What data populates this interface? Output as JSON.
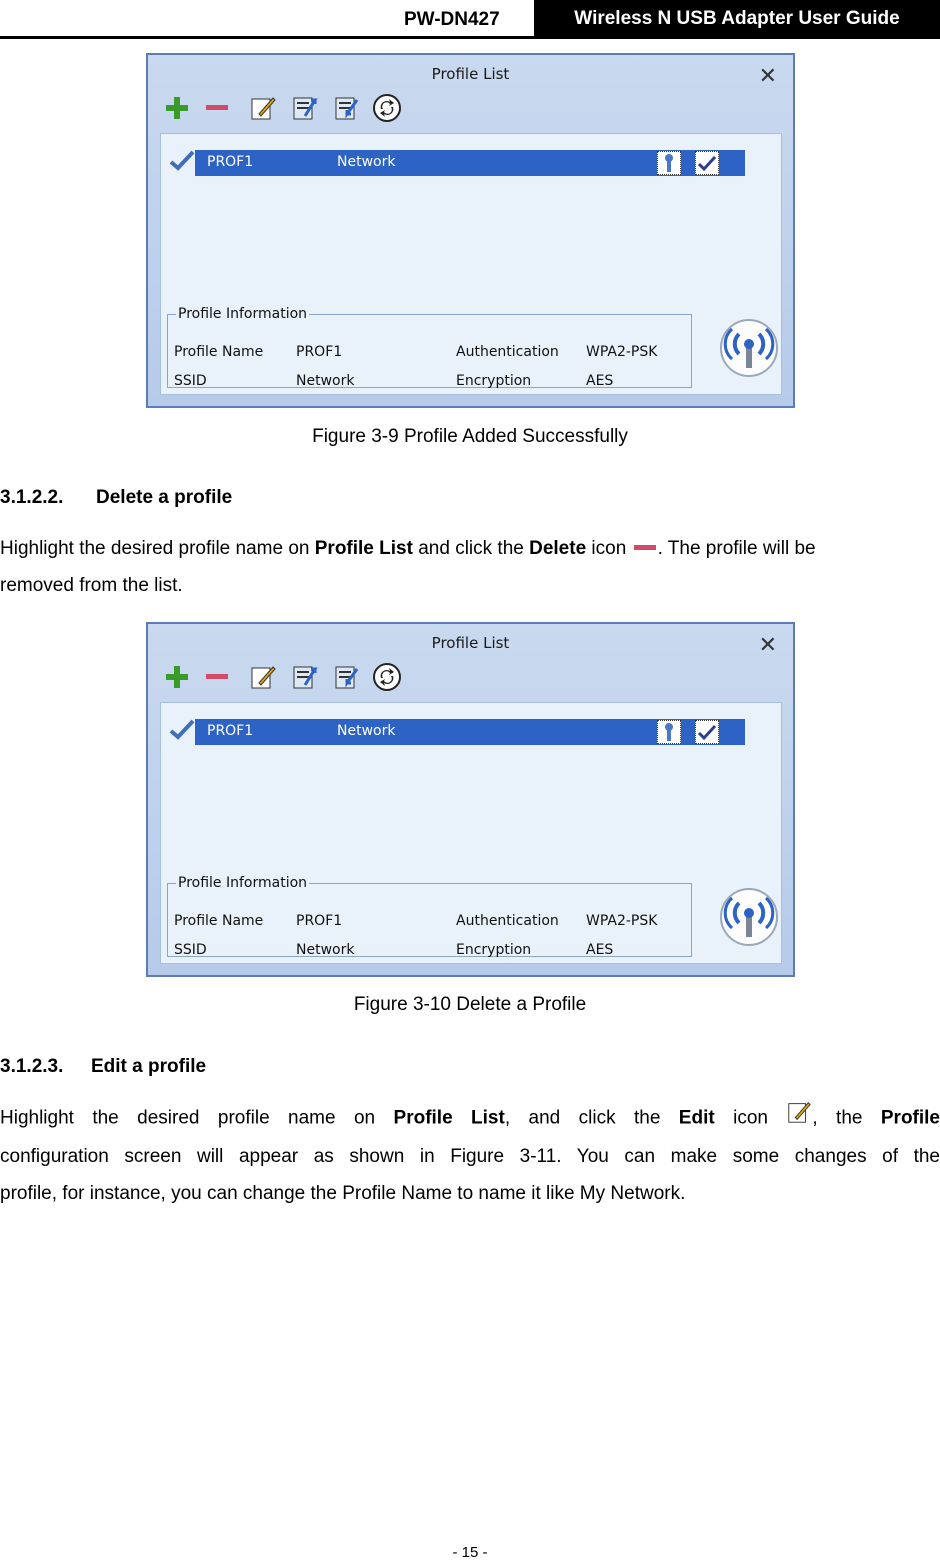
{
  "header": {
    "model": "PW-DN427",
    "title": "Wireless N USB Adapter User Guide"
  },
  "profile_window": {
    "title": "Profile List",
    "close_symbol": "✕",
    "toolbar_icons": [
      "add-icon",
      "delete-icon",
      "edit-icon",
      "import-icon",
      "export-icon",
      "scan-icon"
    ],
    "profile_row": {
      "name": "PROF1",
      "ssid": "Network"
    },
    "info": {
      "legend": "Profile Information",
      "profile_name_label": "Profile Name",
      "profile_name_value": "PROF1",
      "ssid_label": "SSID",
      "ssid_value": "Network",
      "auth_label": "Authentication",
      "auth_value": "WPA2-PSK",
      "enc_label": "Encryption",
      "enc_value": "AES"
    }
  },
  "captions": {
    "fig1": "Figure 3-9 Profile Added Successfully",
    "fig2": "Figure 3-10 Delete a Profile"
  },
  "sections": {
    "delete": {
      "number": "3.1.2.2.",
      "title": "Delete a profile",
      "p1": "Highlight the desired profile name on ",
      "b1": "Profile List",
      "p2": " and click the ",
      "b2": "Delete",
      "p3": " icon ",
      "p4": ". The profile will be",
      "line2": "removed from the list."
    },
    "edit": {
      "number": "3.1.2.3.",
      "title": "Edit a profile",
      "p1": "Highlight the desired profile name on ",
      "b1": "Profile List",
      "p2": ", and click the ",
      "b2": "Edit",
      "p3": " icon ",
      "p4": ", the ",
      "b3": "Profile",
      "line2": "configuration screen will appear as shown in Figure 3-11. You can make some changes of the",
      "line3": "profile, for instance, you can change the Profile Name to name it like My Network."
    }
  },
  "footer": {
    "page": "- 15 -"
  }
}
